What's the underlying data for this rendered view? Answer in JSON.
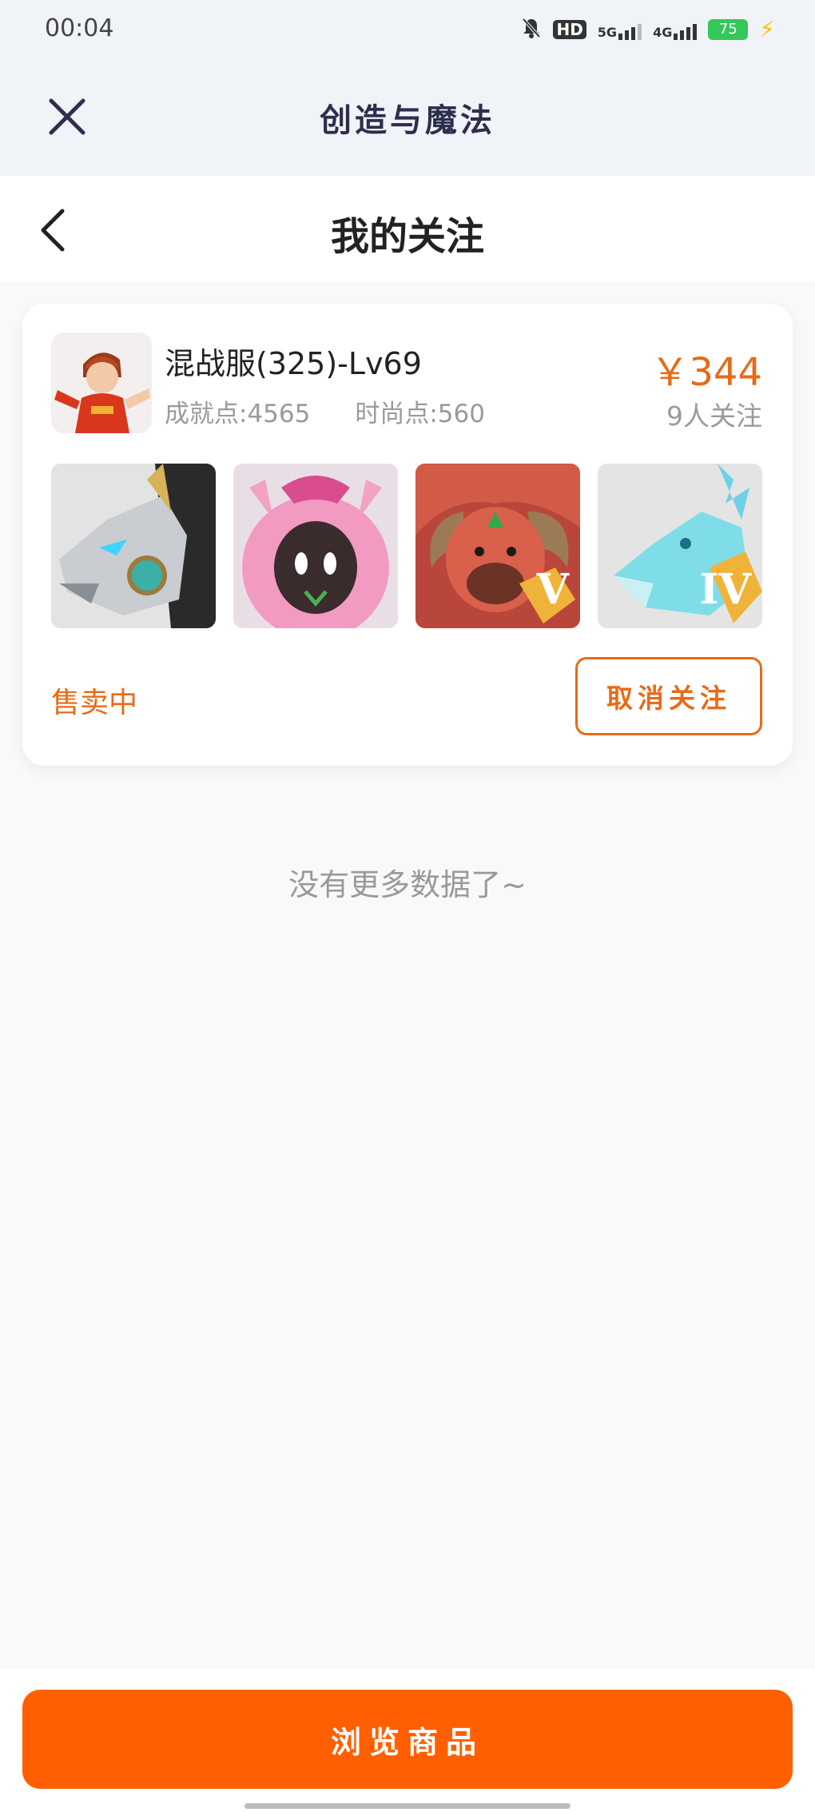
{
  "status_bar": {
    "time": "00:04",
    "icons": [
      "bell-muted-icon",
      "hd-icon",
      "5g-signal-icon",
      "4g-signal-icon",
      "battery-icon",
      "charging-bolt-icon"
    ],
    "hd_label": "HD",
    "net1_label": "5G",
    "net2_label": "4G",
    "battery_level": "75"
  },
  "app_header": {
    "title": "创造与魔法",
    "close_icon": "close-icon"
  },
  "page_header": {
    "title": "我的关注",
    "back_icon": "chevron-left-icon"
  },
  "card": {
    "item_name": "混战服(325)-Lv69",
    "achievement_points": "成就点:4565",
    "fashion_points": "时尚点:560",
    "price": "￥344",
    "followers": "9人关注",
    "thumbnails": [
      {
        "name": "mecha-wolf-mount",
        "rank": ""
      },
      {
        "name": "pink-bunny-pet",
        "rank": ""
      },
      {
        "name": "red-bull-mount",
        "rank": "V"
      },
      {
        "name": "ice-dragon-mount",
        "rank": "IV"
      }
    ],
    "status": "售卖中",
    "unfollow_label": "取消关注"
  },
  "list_footer": "没有更多数据了~",
  "bottom": {
    "browse_label": "浏览商品"
  },
  "colors": {
    "accent": "#e86a17",
    "primary_button": "#ff5f00",
    "header_bg": "#f0f3f7",
    "title_color": "#2c2f4c"
  }
}
